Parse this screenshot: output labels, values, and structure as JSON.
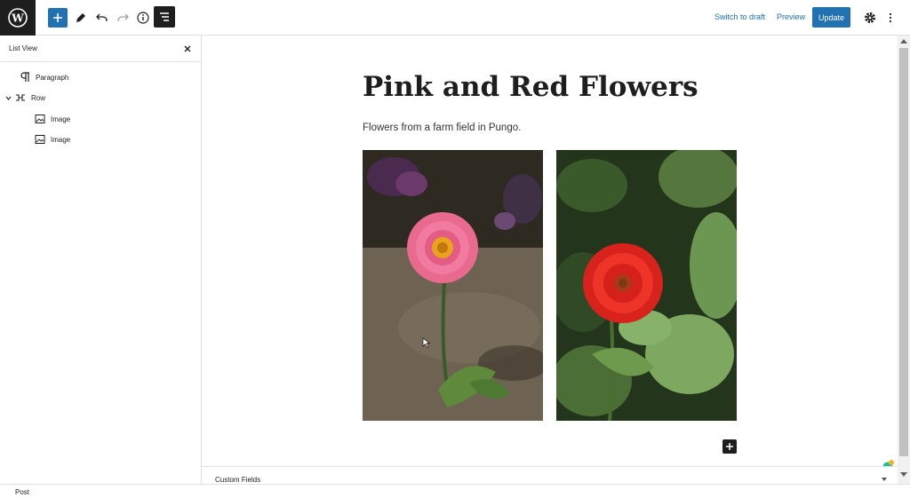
{
  "toolbar": {
    "logo": "wordpress-icon",
    "add_block": "plus-icon",
    "tools": "pencil-icon",
    "undo": "undo-icon",
    "redo": "redo-icon",
    "details": "info-icon",
    "list_view": "list-view-icon",
    "switch_to_draft": "Switch to draft",
    "preview": "Preview",
    "update": "Update",
    "settings": "gear-icon",
    "options": "more-vertical-icon"
  },
  "sidebar": {
    "title": "List View",
    "items": [
      {
        "label": "Paragraph",
        "icon": "paragraph-icon",
        "level": 0,
        "expandable": false
      },
      {
        "label": "Row",
        "icon": "row-icon",
        "level": 0,
        "expandable": true,
        "expanded": true
      },
      {
        "label": "Image",
        "icon": "image-icon",
        "level": 1,
        "expandable": false
      },
      {
        "label": "Image",
        "icon": "image-icon",
        "level": 1,
        "expandable": false
      }
    ]
  },
  "editor": {
    "title": "Pink and Red Flowers",
    "paragraph": "Flowers from a farm field in Pungo."
  },
  "metabox": {
    "title": "Custom Fields"
  },
  "footer": {
    "breadcrumb": "Post"
  },
  "colors": {
    "accent": "#2271b1",
    "dark": "#1e1e1e",
    "border": "#e0e0e0"
  }
}
